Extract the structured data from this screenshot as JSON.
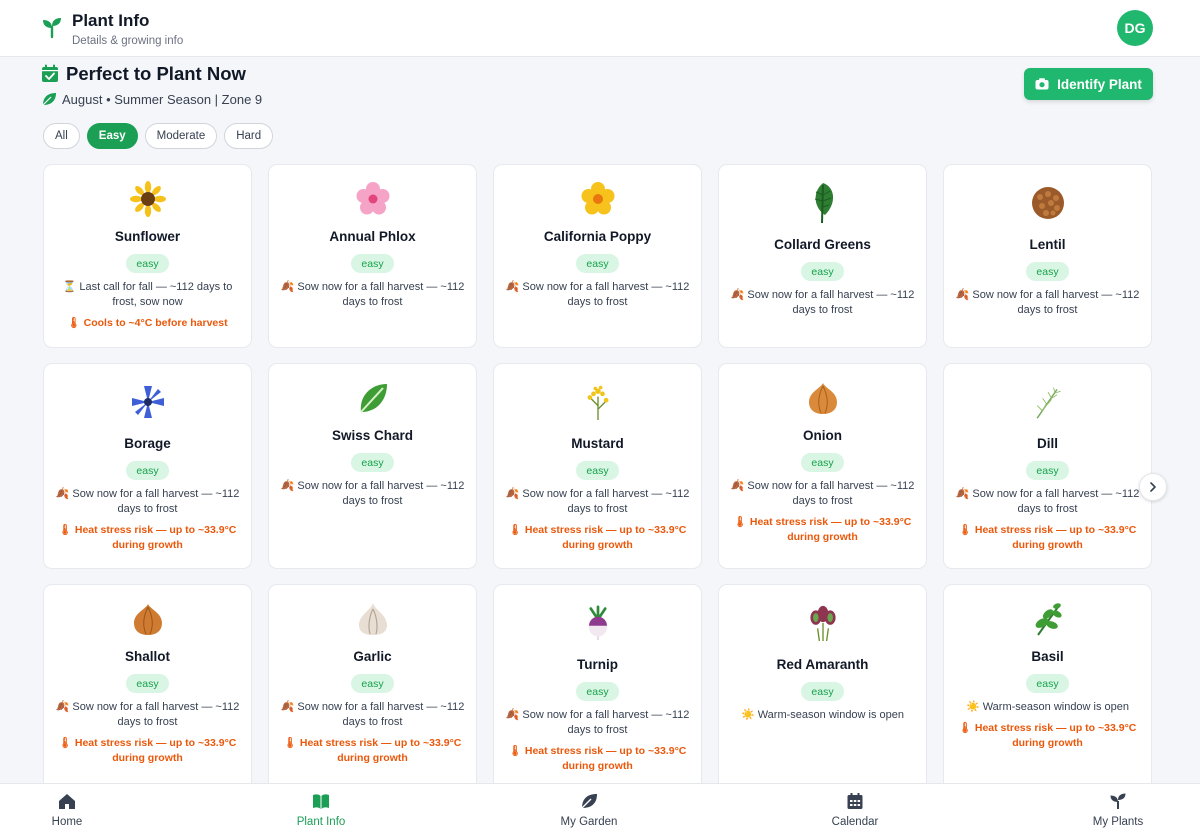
{
  "header": {
    "title": "Plant Info",
    "subtitle": "Details & growing info",
    "avatar_initials": "DG"
  },
  "section": {
    "title": "Perfect to Plant Now",
    "subtitle": "August • Summer Season | Zone 9"
  },
  "identify_button": {
    "label": "Identify Plant"
  },
  "filters": [
    {
      "label": "All",
      "active": false
    },
    {
      "label": "Easy",
      "active": true
    },
    {
      "label": "Moderate",
      "active": false
    },
    {
      "label": "Hard",
      "active": false
    }
  ],
  "plants": [
    {
      "name": "Sunflower",
      "difficulty": "easy",
      "note": "⏳ Last call for fall — ~112 days to frost, sow now",
      "warning": "🌡 Cools to ~4°C before harvest",
      "icon": "sunflower-icon"
    },
    {
      "name": "Annual Phlox",
      "difficulty": "easy",
      "note": "🍂 Sow now for a fall harvest — ~112 days to frost",
      "warning": "",
      "icon": "phlox-icon"
    },
    {
      "name": "California Poppy",
      "difficulty": "easy",
      "note": "🍂 Sow now for a fall harvest — ~112 days to frost",
      "warning": "",
      "icon": "poppy-icon"
    },
    {
      "name": "Collard Greens",
      "difficulty": "easy",
      "note": "🍂 Sow now for a fall harvest — ~112 days to frost",
      "warning": "",
      "icon": "collard-icon"
    },
    {
      "name": "Lentil",
      "difficulty": "easy",
      "note": "🍂 Sow now for a fall harvest — ~112 days to frost",
      "warning": "",
      "icon": "lentil-icon"
    },
    {
      "name": "Borage",
      "difficulty": "easy",
      "note": "🍂 Sow now for a fall harvest — ~112 days to frost",
      "warning": "🌡 Heat stress risk — up to ~33.9°C during growth",
      "icon": "borage-icon"
    },
    {
      "name": "Swiss Chard",
      "difficulty": "easy",
      "note": "🍂 Sow now for a fall harvest — ~112 days to frost",
      "warning": "",
      "icon": "chard-icon"
    },
    {
      "name": "Mustard",
      "difficulty": "easy",
      "note": "🍂 Sow now for a fall harvest — ~112 days to frost",
      "warning": "🌡 Heat stress risk — up to ~33.9°C during growth",
      "icon": "mustard-icon"
    },
    {
      "name": "Onion",
      "difficulty": "easy",
      "note": "🍂 Sow now for a fall harvest — ~112 days to frost",
      "warning": "🌡 Heat stress risk — up to ~33.9°C during growth",
      "icon": "onion-icon"
    },
    {
      "name": "Dill",
      "difficulty": "easy",
      "note": "🍂 Sow now for a fall harvest — ~112 days to frost",
      "warning": "🌡 Heat stress risk — up to ~33.9°C during growth",
      "icon": "dill-icon"
    },
    {
      "name": "Shallot",
      "difficulty": "easy",
      "note": "🍂 Sow now for a fall harvest — ~112 days to frost",
      "warning": "🌡 Heat stress risk — up to ~33.9°C during growth",
      "icon": "shallot-icon"
    },
    {
      "name": "Garlic",
      "difficulty": "easy",
      "note": "🍂 Sow now for a fall harvest — ~112 days to frost",
      "warning": "🌡 Heat stress risk — up to ~33.9°C during growth",
      "icon": "garlic-icon"
    },
    {
      "name": "Turnip",
      "difficulty": "easy",
      "note": "🍂 Sow now for a fall harvest — ~112 days to frost",
      "warning": "🌡 Heat stress risk — up to ~33.9°C during growth",
      "icon": "turnip-icon"
    },
    {
      "name": "Red Amaranth",
      "difficulty": "easy",
      "note": "☀️ Warm-season window is open",
      "warning": "",
      "icon": "amaranth-icon"
    },
    {
      "name": "Basil",
      "difficulty": "easy",
      "note": "☀️ Warm-season window is open",
      "warning": "🌡 Heat stress risk — up to ~33.9°C during growth",
      "icon": "basil-icon"
    }
  ],
  "bottom_nav": [
    {
      "label": "Home",
      "icon": "home-icon",
      "active": false
    },
    {
      "label": "Plant Info",
      "icon": "book-icon",
      "active": true
    },
    {
      "label": "My Garden",
      "icon": "leaf-icon",
      "active": false
    },
    {
      "label": "Calendar",
      "icon": "calendar-icon",
      "active": false
    },
    {
      "label": "My Plants",
      "icon": "sprout-icon",
      "active": false
    }
  ],
  "colors": {
    "accent": "#1a9f55",
    "badge_bg": "#d9f5e4",
    "warning": "#ea580c"
  }
}
